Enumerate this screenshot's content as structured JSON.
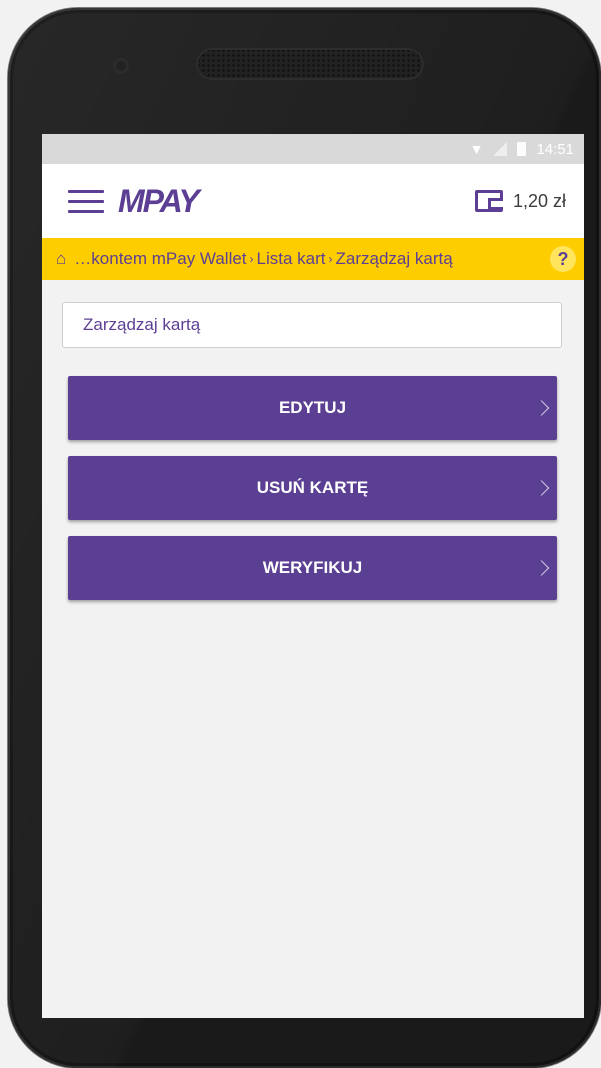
{
  "status_bar": {
    "time": "14:51"
  },
  "header": {
    "logo": "MPAY",
    "balance": "1,20 zł"
  },
  "breadcrumb": {
    "items": [
      "…kontem mPay Wallet",
      "Lista kart",
      "Zarządzaj kartą"
    ],
    "separator": "›",
    "help_label": "?"
  },
  "page": {
    "title": "Zarządzaj kartą"
  },
  "actions": [
    {
      "label": "EDYTUJ"
    },
    {
      "label": "USUŃ KARTĘ"
    },
    {
      "label": "WERYFIKUJ"
    }
  ],
  "colors": {
    "brand_purple": "#5b3f92",
    "breadcrumb_yellow": "#fdcd00"
  }
}
